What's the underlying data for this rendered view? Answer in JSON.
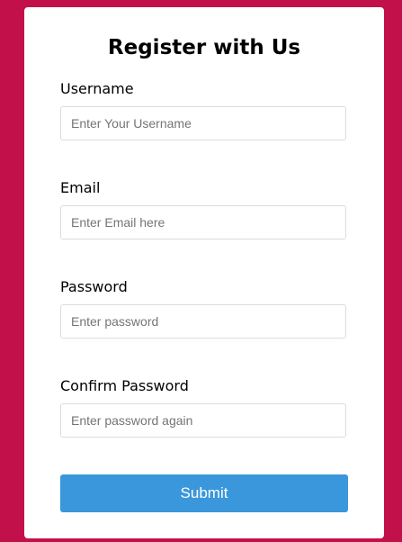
{
  "form": {
    "title": "Register with Us",
    "fields": [
      {
        "label": "Username",
        "placeholder": "Enter Your Username",
        "value": ""
      },
      {
        "label": "Email",
        "placeholder": "Enter Email here",
        "value": ""
      },
      {
        "label": "Password",
        "placeholder": "Enter password",
        "value": ""
      },
      {
        "label": "Confirm Password",
        "placeholder": "Enter password again",
        "value": ""
      }
    ],
    "submit_label": "Submit"
  },
  "colors": {
    "page_background": "#c2104a",
    "card_background": "#ffffff",
    "button_background": "#3a97db",
    "button_text": "#ffffff"
  }
}
